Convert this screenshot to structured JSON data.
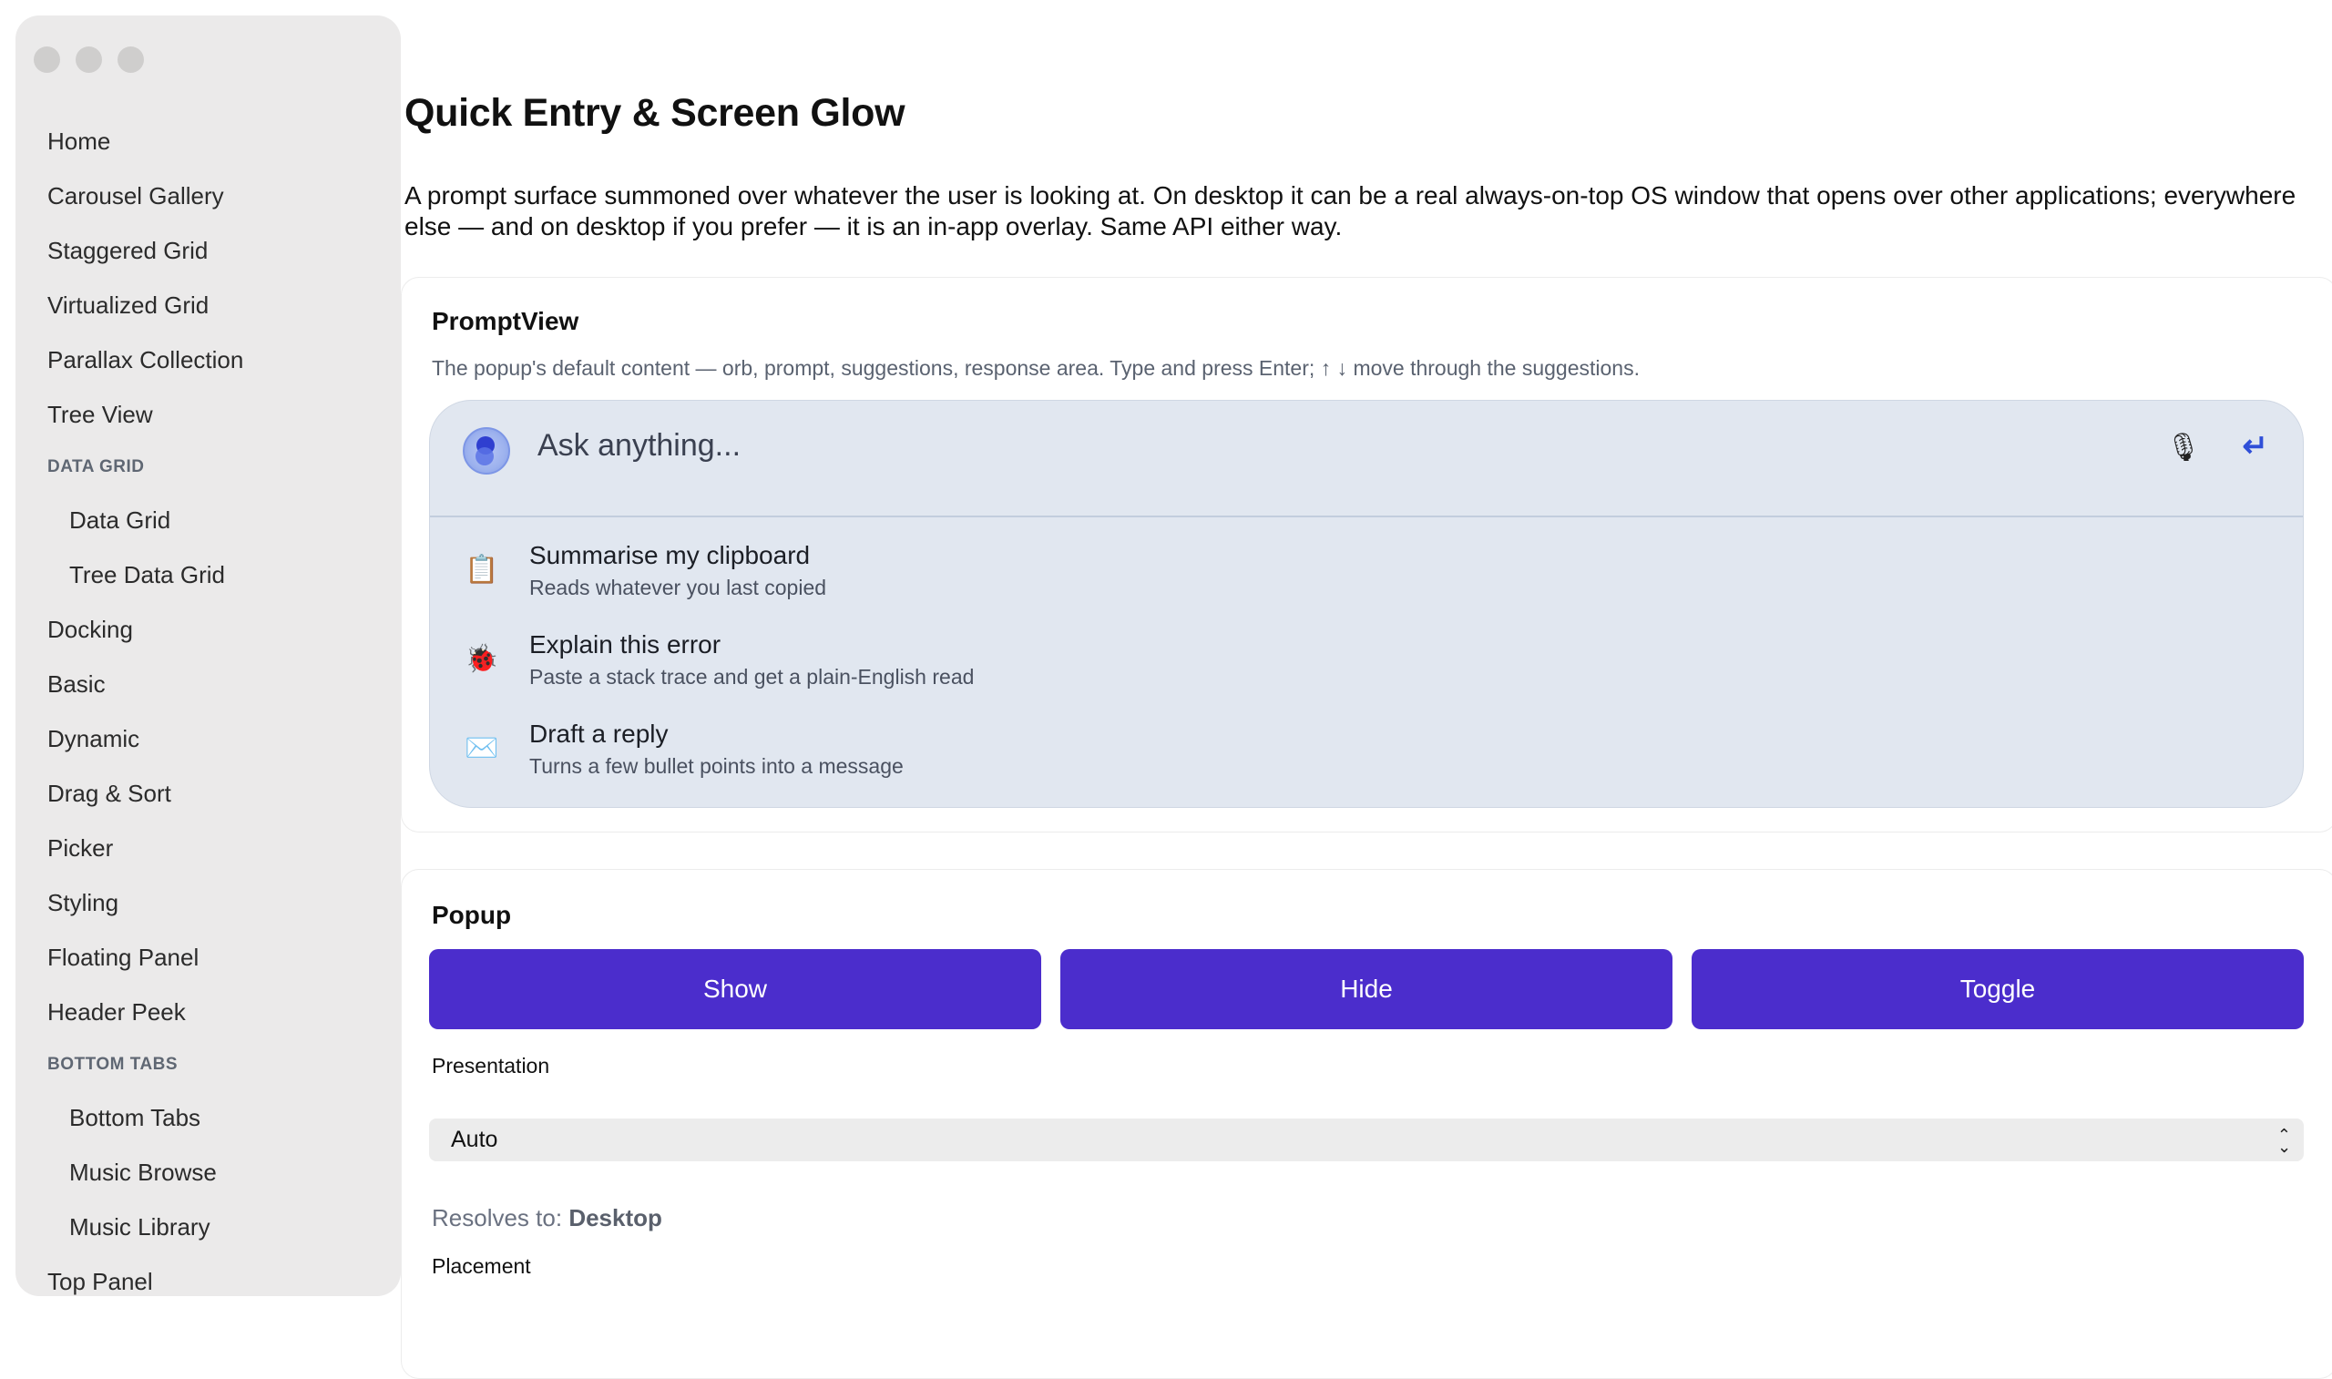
{
  "sidebar": {
    "items": [
      {
        "label": "Home",
        "type": "item"
      },
      {
        "label": "Carousel Gallery",
        "type": "item"
      },
      {
        "label": "Staggered Grid",
        "type": "item"
      },
      {
        "label": "Virtualized Grid",
        "type": "item"
      },
      {
        "label": "Parallax Collection",
        "type": "item"
      },
      {
        "label": "Tree View",
        "type": "item"
      },
      {
        "label": "DATA GRID",
        "type": "section"
      },
      {
        "label": "Data Grid",
        "type": "sub"
      },
      {
        "label": "Tree Data Grid",
        "type": "sub"
      },
      {
        "label": "Docking",
        "type": "item"
      },
      {
        "label": "Basic",
        "type": "item"
      },
      {
        "label": "Dynamic",
        "type": "item"
      },
      {
        "label": "Drag & Sort",
        "type": "item"
      },
      {
        "label": "Picker",
        "type": "item"
      },
      {
        "label": "Styling",
        "type": "item"
      },
      {
        "label": "Floating Panel",
        "type": "item"
      },
      {
        "label": "Header Peek",
        "type": "item"
      },
      {
        "label": "BOTTOM TABS",
        "type": "section"
      },
      {
        "label": "Bottom Tabs",
        "type": "sub"
      },
      {
        "label": "Music Browse",
        "type": "sub"
      },
      {
        "label": "Music Library",
        "type": "sub"
      },
      {
        "label": "Top Panel",
        "type": "item"
      }
    ]
  },
  "page": {
    "title": "Quick Entry & Screen Glow",
    "description": "A prompt surface summoned over whatever the user is looking at. On desktop it can be a real always-on-top OS window that opens over other applications; everywhere else — and on desktop if you prefer — it is an in-app overlay. Same API either way."
  },
  "prompt_view": {
    "title": "PromptView",
    "subtitle": "The popup's default content — orb, prompt, suggestions, response area. Type and press Enter; ↑ ↓ move through the suggestions.",
    "placeholder": "Ask anything...",
    "mic_icon": "🎙",
    "enter_icon": "↵",
    "suggestions": [
      {
        "icon": "📋",
        "title": "Summarise my clipboard",
        "desc": "Reads whatever you last copied"
      },
      {
        "icon": "🐞",
        "title": "Explain this error",
        "desc": "Paste a stack trace and get a plain-English read"
      },
      {
        "icon": "✉️",
        "title": "Draft a reply",
        "desc": "Turns a few bullet points into a message"
      }
    ]
  },
  "popup": {
    "title": "Popup",
    "show_label": "Show",
    "hide_label": "Hide",
    "toggle_label": "Toggle",
    "presentation_label": "Presentation",
    "presentation_value": "Auto",
    "resolves_prefix": "Resolves to:",
    "resolves_value": "Desktop",
    "placement_label": "Placement"
  },
  "colors": {
    "accent": "#4b2dcc",
    "prompt_bg": "#e1e7f0",
    "sidebar_bg": "#ebeaea"
  }
}
